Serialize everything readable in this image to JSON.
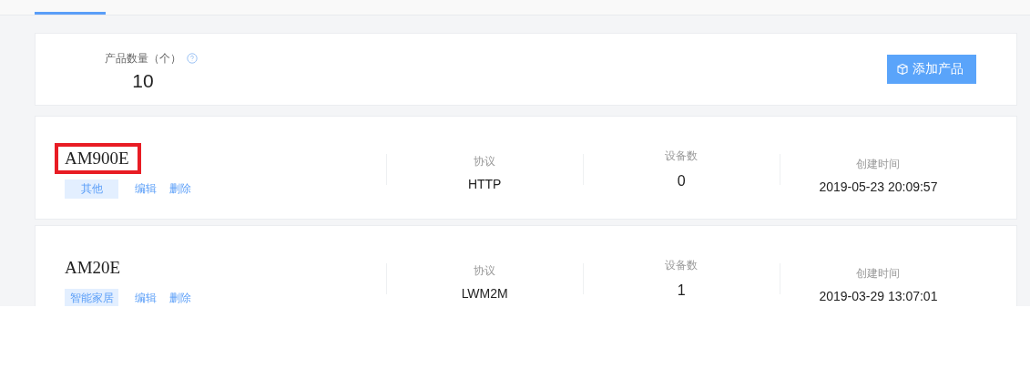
{
  "tabs": [
    {
      "selected": true
    }
  ],
  "summary": {
    "label": "产品数量（个）",
    "count": "10",
    "add_button": "添加产品"
  },
  "products": [
    {
      "name": "AM900E",
      "highlighted": true,
      "category": "其他",
      "edit": "编辑",
      "delete": "删除",
      "protocol_label": "协议",
      "protocol": "HTTP",
      "devices_label": "设备数",
      "devices": "0",
      "created_label": "创建时间",
      "created": "2019-05-23 20:09:57"
    },
    {
      "name": "AM20E",
      "highlighted": false,
      "category": "智能家居",
      "edit": "编辑",
      "delete": "删除",
      "protocol_label": "协议",
      "protocol": "LWM2M",
      "devices_label": "设备数",
      "devices": "1",
      "created_label": "创建时间",
      "created": "2019-03-29 13:07:01"
    }
  ]
}
